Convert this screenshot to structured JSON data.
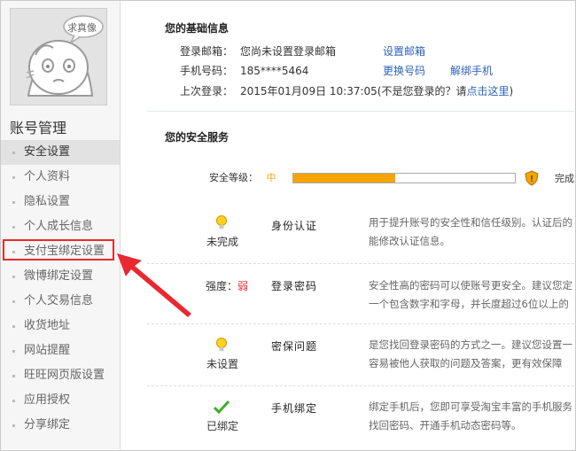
{
  "sidebar": {
    "avatar_badge": "求真像",
    "title": "账号管理",
    "items": [
      {
        "label": "安全设置"
      },
      {
        "label": "个人资料"
      },
      {
        "label": "隐私设置"
      },
      {
        "label": "个人成长信息"
      },
      {
        "label": "支付宝绑定设置"
      },
      {
        "label": "微博绑定设置"
      },
      {
        "label": "个人交易信息"
      },
      {
        "label": "收货地址"
      },
      {
        "label": "网站提醒"
      },
      {
        "label": "旺旺网页版设置"
      },
      {
        "label": "应用授权"
      },
      {
        "label": "分享绑定"
      }
    ]
  },
  "basic_info": {
    "title": "您的基础信息",
    "email_label": "登录邮箱：",
    "email_value": "您尚未设置登录邮箱",
    "email_link": "设置邮箱",
    "phone_label": "手机号码：",
    "phone_value": "185****5464",
    "phone_link1": "更换号码",
    "phone_link2": "解绑手机",
    "last_label": "上次登录：",
    "last_value": "2015年01月09日 10:37:05(不是您登录的？请",
    "last_link": "点击这里",
    "last_tail": ")"
  },
  "security": {
    "title": "您的安全服务",
    "level_label": "安全等级：",
    "level_value": "中",
    "level_progress": 0.46,
    "done_label": "完成",
    "services": [
      {
        "status": "未完成",
        "name": "身份认证",
        "desc1": "用于提升账号的安全性和信任级别。认证后的",
        "desc2": "能修改认证信息。"
      },
      {
        "status_prefix": "强度：",
        "status_value": "弱",
        "name": "登录密码",
        "desc1": "安全性高的密码可以使账号更安全。建议您定",
        "desc2": "一个包含数字和字母，并长度超过6位以上的"
      },
      {
        "status": "未设置",
        "name": "密保问题",
        "desc1": "是您找回登录密码的方式之一。建议您设置一",
        "desc2": "容易被他人获取的问题及答案，更有效保障"
      },
      {
        "status": "已绑定",
        "name": "手机绑定",
        "desc1": "绑定手机后，您即可享受淘宝丰富的手机服务",
        "desc2": "找回密码、开通手机动态密码等。"
      }
    ]
  },
  "colors": {
    "accent_link": "#2c63b9",
    "progress": "#f5a400",
    "alert_red": "#e9292f"
  }
}
